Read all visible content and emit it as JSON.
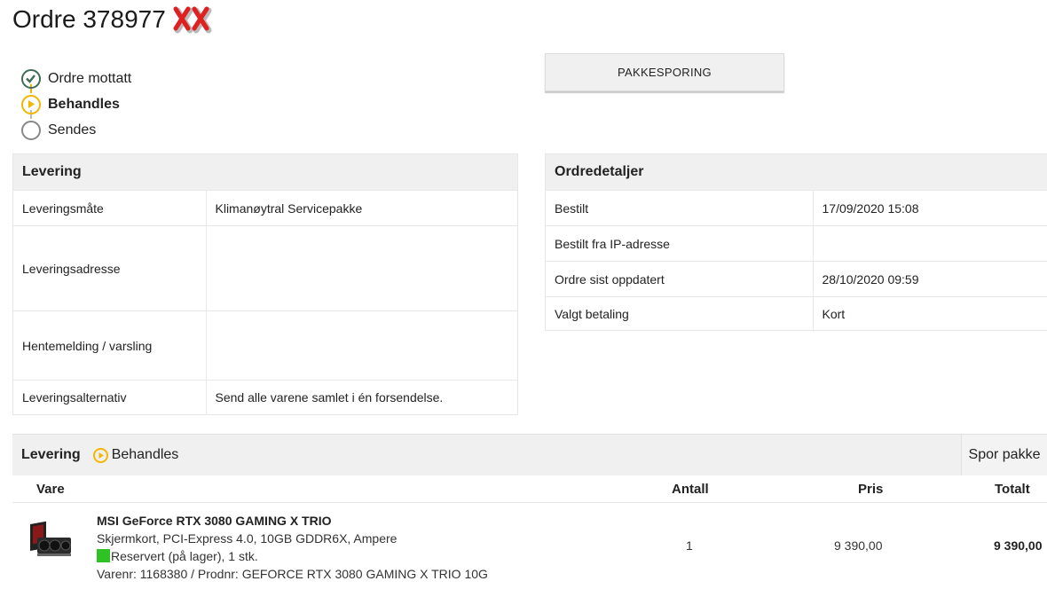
{
  "order": {
    "title": "Ordre 378977"
  },
  "steps": [
    {
      "label": "Ordre mottatt",
      "state": "done",
      "icon": "check-circle-icon"
    },
    {
      "label": "Behandles",
      "state": "active",
      "icon": "play-circle-icon"
    },
    {
      "label": "Sendes",
      "state": "todo",
      "icon": "empty-circle-icon"
    }
  ],
  "buttons": {
    "tracking": "PAKKESPORING",
    "track_package": "Spor pakke"
  },
  "delivery_panel": {
    "title": "Levering",
    "rows": [
      {
        "key": "Leveringsmåte",
        "value": "Klimanøytral Servicepakke"
      },
      {
        "key": "Leveringsadresse",
        "value": ""
      },
      {
        "key": "Hentemelding / varsling",
        "value": ""
      },
      {
        "key": "Leveringsalternativ",
        "value": "Send alle varene samlet i én forsendelse."
      }
    ]
  },
  "order_details": {
    "title": "Ordredetaljer",
    "rows": [
      {
        "key": "Bestilt",
        "value": "17/09/2020 15:08"
      },
      {
        "key": "Bestilt fra IP-adresse",
        "value": ""
      },
      {
        "key": "Ordre sist oppdatert",
        "value": "28/10/2020 09:59"
      },
      {
        "key": "Valgt betaling",
        "value": "Kort"
      }
    ]
  },
  "shipment": {
    "title": "Levering",
    "status": "Behandles",
    "columns": {
      "item": "Vare",
      "qty": "Antall",
      "price": "Pris",
      "total": "Totalt"
    },
    "items": [
      {
        "name": "MSI GeForce RTX 3080 GAMING X TRIO",
        "description": "Skjermkort, PCI-Express 4.0, 10GB GDDR6X, Ampere",
        "stock": "Reservert (på lager), 1 stk.",
        "sku": "Varenr: 1168380 / Prodnr: GEFORCE RTX 3080 GAMING X TRIO 10G",
        "qty": "1",
        "price": "9 390,00",
        "total": "9 390,00"
      }
    ]
  },
  "colors": {
    "done": "#3f6b57",
    "active": "#f2b705",
    "stock": "#2ec224",
    "redaction": "#e02020"
  }
}
